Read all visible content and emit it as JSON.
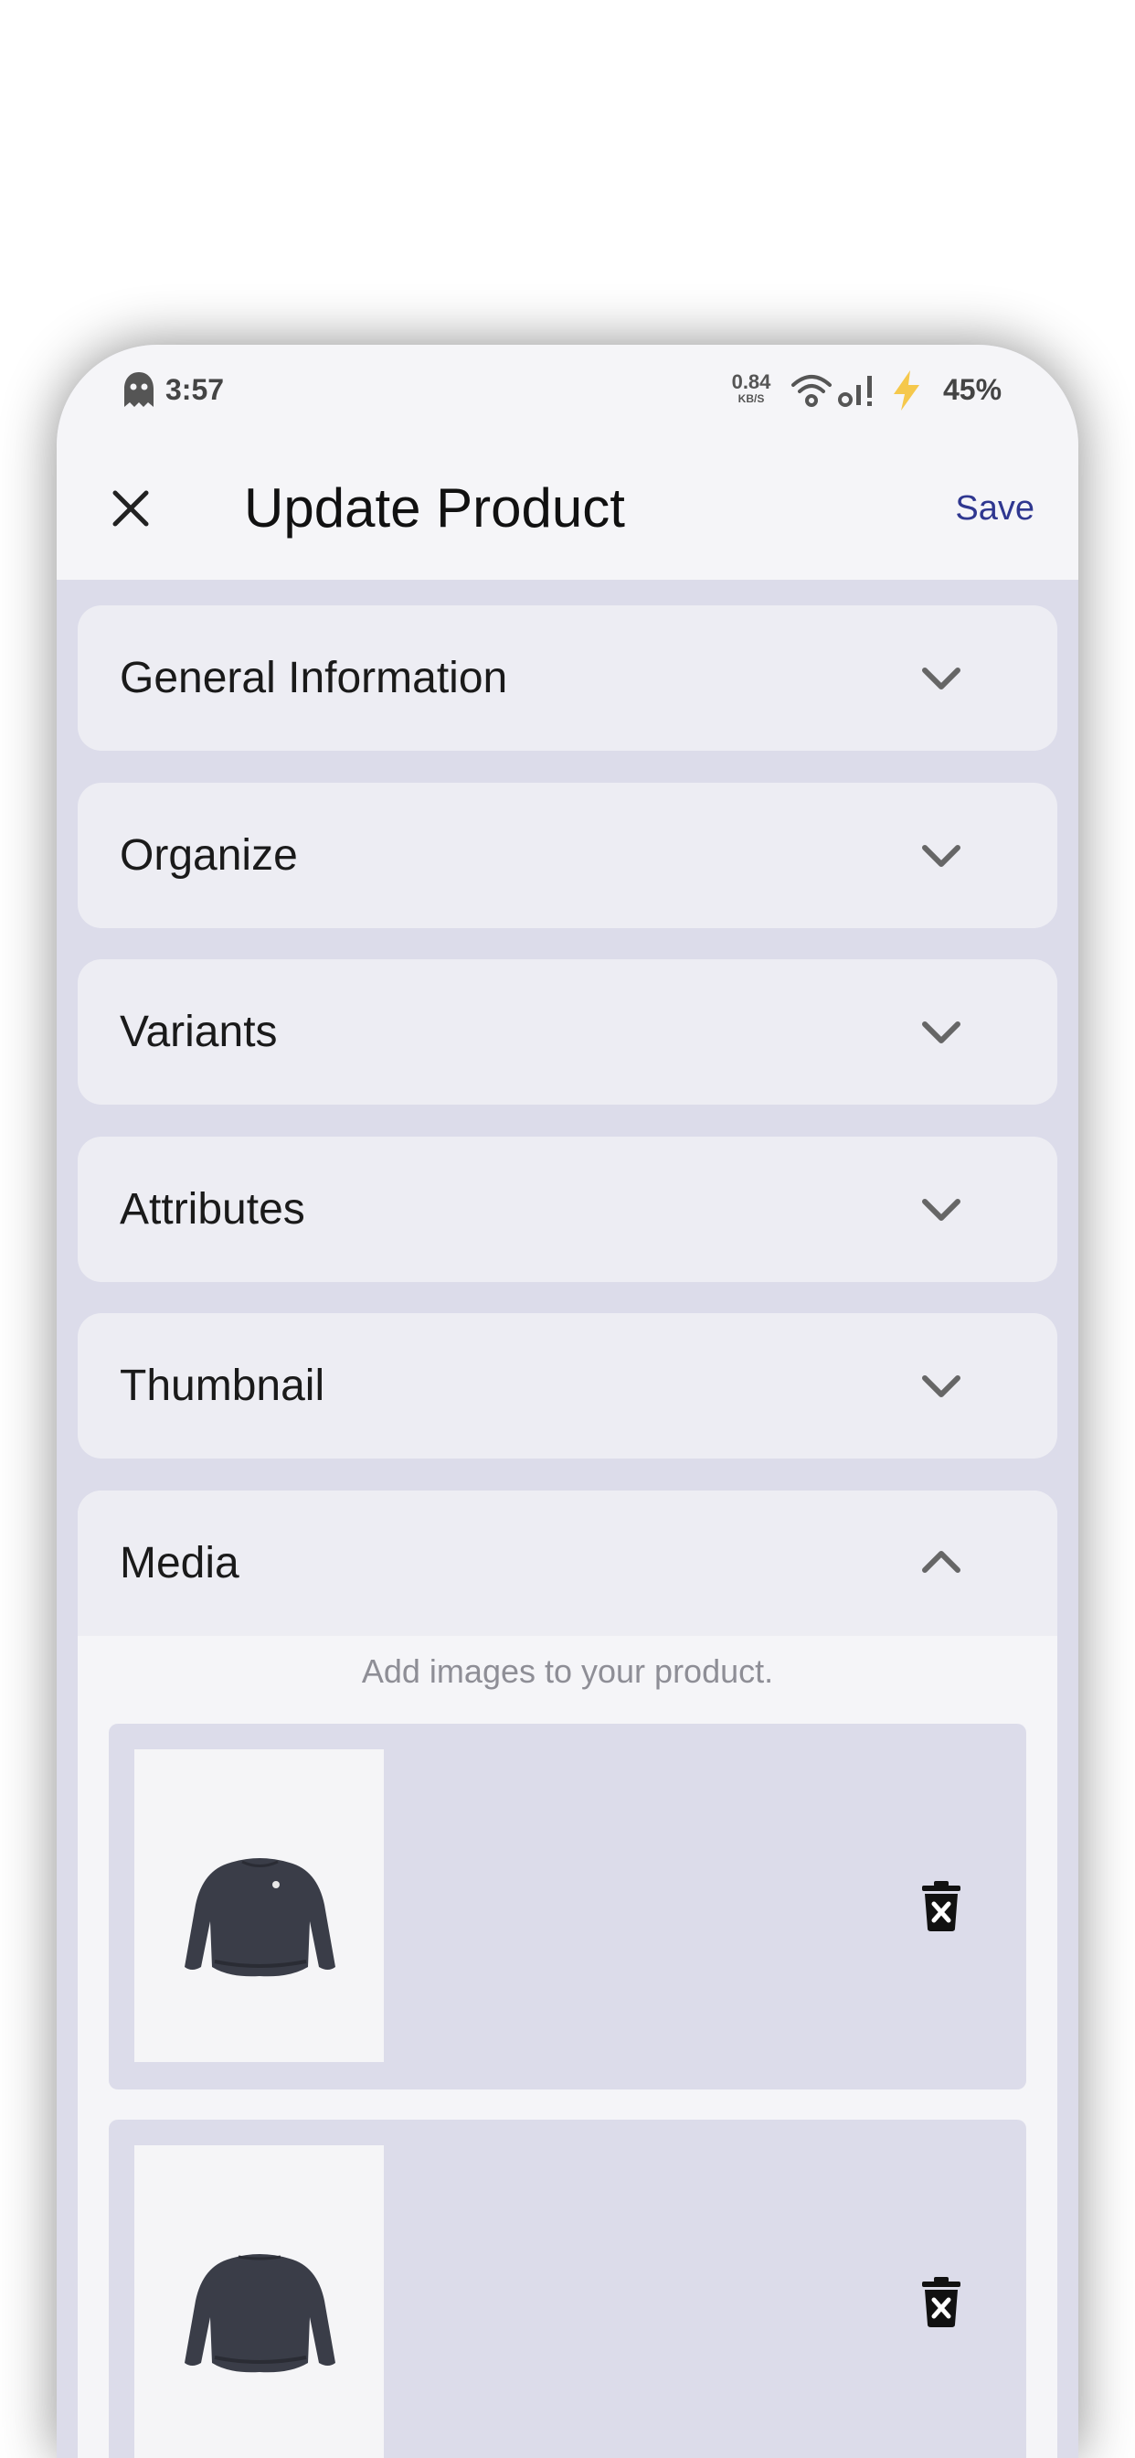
{
  "status_bar": {
    "time": "3:57",
    "net_speed_value": "0.84",
    "net_speed_unit": "KB/S",
    "battery": "45%",
    "icons": [
      "ghost-icon",
      "wifi-icon",
      "signal-icon",
      "charging-bolt-icon"
    ]
  },
  "app_bar": {
    "title": "Update Product",
    "save_label": "Save",
    "close_icon": "close-icon"
  },
  "sections": [
    {
      "label": "General Information",
      "expanded": false
    },
    {
      "label": "Organize",
      "expanded": false
    },
    {
      "label": "Variants",
      "expanded": false
    },
    {
      "label": "Attributes",
      "expanded": false
    },
    {
      "label": "Thumbnail",
      "expanded": false
    },
    {
      "label": "Media",
      "expanded": true
    }
  ],
  "media": {
    "hint": "Add images to your product.",
    "items": [
      {
        "image": "sweatshirt-photo-front",
        "delete_icon": "delete-icon"
      },
      {
        "image": "sweatshirt-photo-back",
        "delete_icon": "delete-icon"
      }
    ]
  },
  "colors": {
    "accent": "#2f3790",
    "surface": "#f5f5f8",
    "card": "#ededf3",
    "background": "#dcdcea",
    "bolt": "#f5c84c"
  }
}
